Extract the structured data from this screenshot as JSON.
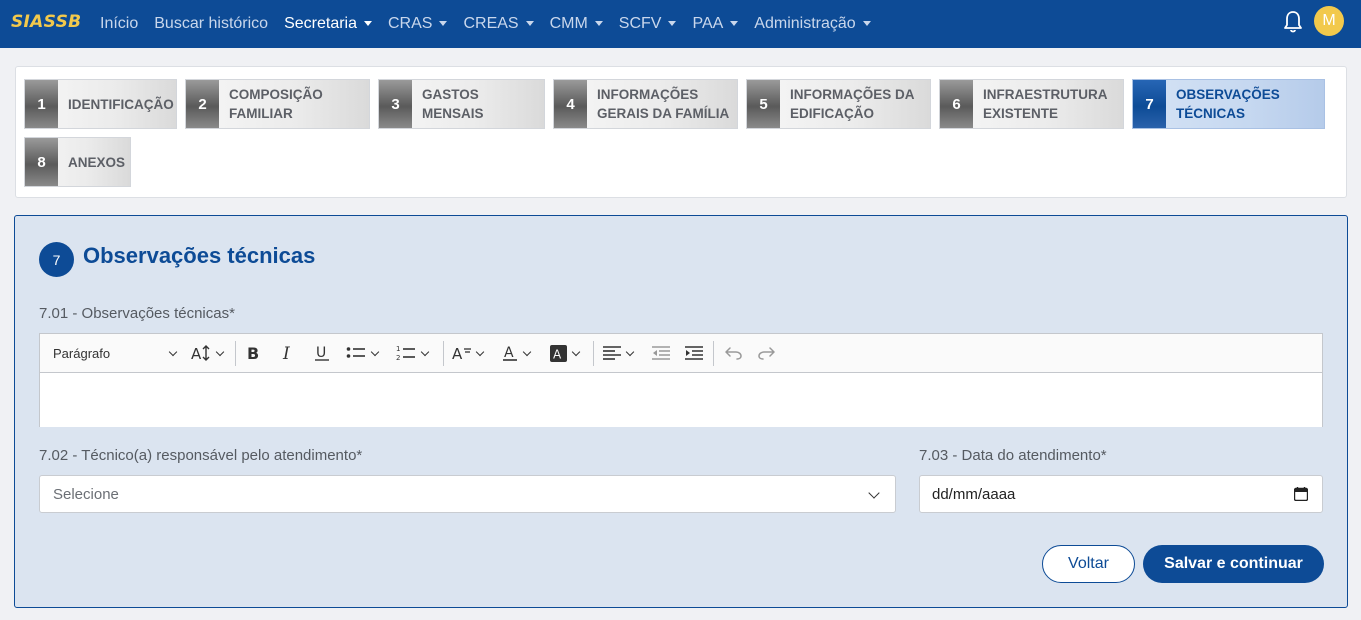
{
  "navbar": {
    "brand": "SIASSB",
    "items": [
      {
        "label": "Início",
        "dropdown": false,
        "active": false
      },
      {
        "label": "Buscar histórico",
        "dropdown": false,
        "active": false
      },
      {
        "label": "Secretaria",
        "dropdown": true,
        "active": true
      },
      {
        "label": "CRAS",
        "dropdown": true,
        "active": false
      },
      {
        "label": "CREAS",
        "dropdown": true,
        "active": false
      },
      {
        "label": "CMM",
        "dropdown": true,
        "active": false
      },
      {
        "label": "SCFV",
        "dropdown": true,
        "active": false
      },
      {
        "label": "PAA",
        "dropdown": true,
        "active": false
      },
      {
        "label": "Administração",
        "dropdown": true,
        "active": false
      }
    ],
    "bell_icon": "bell-icon",
    "avatar_initial": "M",
    "colors": {
      "bar": "#0d4b96",
      "brand": "#f2c94c",
      "avatar": "#f2c94c"
    }
  },
  "steps": [
    {
      "num": "1",
      "label": "IDENTIFICAÇÃO",
      "active": false
    },
    {
      "num": "2",
      "label": "COMPOSIÇÃO\nFAMILIAR",
      "active": false
    },
    {
      "num": "3",
      "label": "GASTOS MENSAIS",
      "active": false
    },
    {
      "num": "4",
      "label": "INFORMAÇÕES\nGERAIS DA FAMÍLIA",
      "active": false
    },
    {
      "num": "5",
      "label": "INFORMAÇÕES DA\nEDIFICAÇÃO",
      "active": false
    },
    {
      "num": "6",
      "label": "INFRAESTRUTURA\nEXISTENTE",
      "active": false
    },
    {
      "num": "7",
      "label": "OBSERVAÇÕES\nTÉCNICAS",
      "active": true
    },
    {
      "num": "8",
      "label": "ANEXOS",
      "active": false
    }
  ],
  "section": {
    "number": "7",
    "title": "Observações técnicas"
  },
  "fields": {
    "observacoes_label": "7.01 - Observações técnicas*",
    "editor": {
      "paragraph_style": "Parágrafo",
      "body_value": "",
      "tool_icons": [
        "paragraph-dropdown-icon",
        "font-size-icon",
        "bold-icon",
        "italic-icon",
        "underline-icon",
        "bulleted-list-icon",
        "numbered-list-icon",
        "text-style-icon",
        "font-color-icon",
        "background-color-icon",
        "align-icon",
        "outdent-icon",
        "indent-icon",
        "undo-icon",
        "redo-icon"
      ]
    },
    "tecnico_label": "7.02 - Técnico(a) responsável pelo atendimento*",
    "tecnico_value": "Selecione",
    "data_label": "7.03 - Data do atendimento*",
    "data_value": "dd/mm/aaaa"
  },
  "buttons": {
    "back": "Voltar",
    "save": "Salvar e continuar"
  },
  "colors": {
    "primary": "#0d4b96",
    "form_bg": "#dbe4f0",
    "page_bg": "#f0f1f4"
  }
}
